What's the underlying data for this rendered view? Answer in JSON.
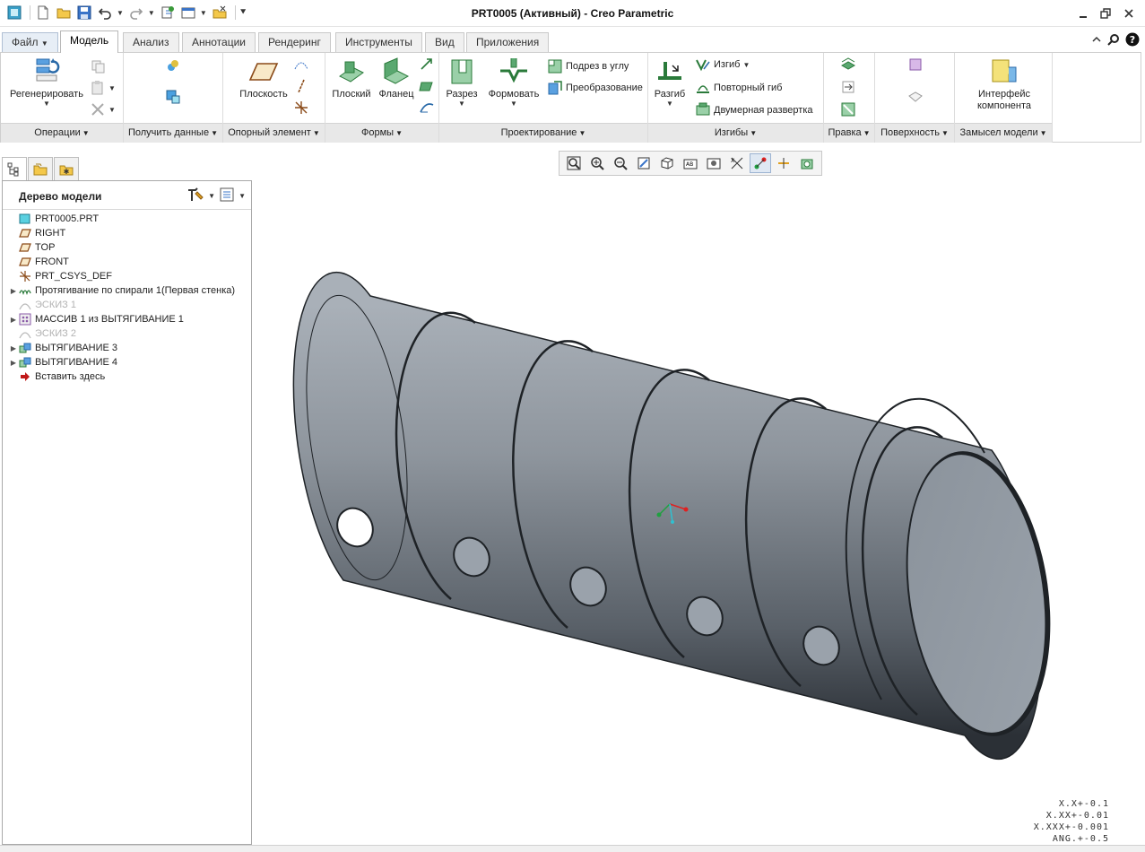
{
  "window": {
    "title": "PRT0005 (Активный) - Creo Parametric"
  },
  "ribbon": {
    "tabs": [
      {
        "label": "Файл",
        "dropdown": true
      },
      {
        "label": "Модель",
        "active": true
      },
      {
        "label": "Анализ"
      },
      {
        "label": "Аннотации"
      },
      {
        "label": "Рендеринг"
      },
      {
        "label": "Инструменты"
      },
      {
        "label": "Вид"
      },
      {
        "label": "Приложения"
      }
    ],
    "groups": {
      "operations": {
        "label": "Операции",
        "regenerate": "Регенерировать"
      },
      "get_data": {
        "label": "Получить данные"
      },
      "datum": {
        "label": "Опорный элемент",
        "plane": "Плоскость"
      },
      "shapes": {
        "label": "Формы",
        "flat": "Плоский",
        "flange": "Фланец"
      },
      "engineering": {
        "label": "Проектирование",
        "cut": "Разрез",
        "form": "Формовать",
        "corner_relief": "Подрез в углу",
        "transform": "Преобразование"
      },
      "bends": {
        "label": "Изгибы",
        "unbend": "Разгиб",
        "bend": "Изгиб",
        "bend_back": "Повторный гиб",
        "flat_pattern": "Двумерная развертка"
      },
      "editing": {
        "label": "Правка"
      },
      "surfaces": {
        "label": "Поверхность"
      },
      "design_intent": {
        "label": "Замысел модели",
        "component_interface": "Интерфейс компонента"
      }
    }
  },
  "model_tree": {
    "title": "Дерево модели",
    "items": [
      {
        "label": "PRT0005.PRT",
        "icon": "part-icon",
        "expandable": false,
        "dim": false
      },
      {
        "label": "RIGHT",
        "icon": "datum-plane-icon",
        "expandable": false,
        "dim": false
      },
      {
        "label": "TOP",
        "icon": "datum-plane-icon",
        "expandable": false,
        "dim": false
      },
      {
        "label": "FRONT",
        "icon": "datum-plane-icon",
        "expandable": false,
        "dim": false
      },
      {
        "label": "PRT_CSYS_DEF",
        "icon": "csys-icon",
        "expandable": false,
        "dim": false
      },
      {
        "label": "Протягивание по спирали 1(Первая стенка)",
        "icon": "helical-sweep-icon",
        "expandable": true,
        "dim": false
      },
      {
        "label": "ЭСКИЗ 1",
        "icon": "sketch-icon",
        "expandable": false,
        "dim": true
      },
      {
        "label": "МАССИВ 1 из ВЫТЯГИВАНИЕ 1",
        "icon": "pattern-icon",
        "expandable": true,
        "dim": false
      },
      {
        "label": "ЭСКИЗ 2",
        "icon": "sketch-icon",
        "expandable": false,
        "dim": true
      },
      {
        "label": "ВЫТЯГИВАНИЕ 3",
        "icon": "extrude-icon",
        "expandable": true,
        "dim": false
      },
      {
        "label": "ВЫТЯГИВАНИЕ 4",
        "icon": "extrude-icon",
        "expandable": true,
        "dim": false
      },
      {
        "label": "Вставить здесь",
        "icon": "insert-here-arrow-icon",
        "expandable": false,
        "dim": false
      }
    ]
  },
  "tolerance": {
    "lines": [
      "X.X+-0.1",
      "X.XX+-0.01",
      "X.XXX+-0.001",
      "ANG.+-0.5"
    ]
  },
  "colors": {
    "model_surface": "#8f969e",
    "model_dark": "#2b3036",
    "csys_x": "#e02020",
    "csys_y": "#20a040",
    "csys_z": "#30c0d0"
  }
}
